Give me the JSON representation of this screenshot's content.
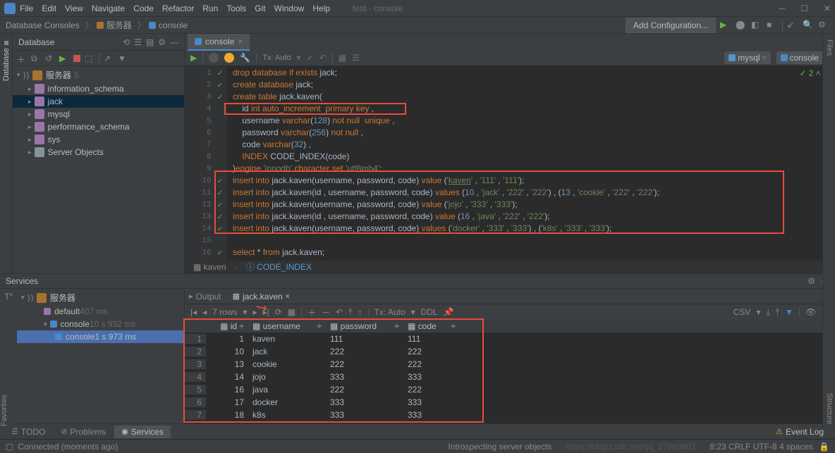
{
  "menu": {
    "file": "File",
    "edit": "Edit",
    "view": "View",
    "navigate": "Navigate",
    "code": "Code",
    "refactor": "Refactor",
    "run": "Run",
    "tools": "Tools",
    "git": "Git",
    "window": "Window",
    "help": "Help"
  },
  "titleText": "test - console",
  "breadcrumbs": {
    "a": "Database Consoles",
    "b": "服务器",
    "c": "console"
  },
  "addConfig": "Add Configuration...",
  "dbPanelTitle": "Database",
  "dbTree": {
    "server": "服务器",
    "serverCount": "5",
    "schemas": [
      "information_schema",
      "jack",
      "mysql",
      "performance_schema",
      "sys"
    ],
    "serverObjects": "Server Objects"
  },
  "tab": {
    "label": "console"
  },
  "toolbarTx": "Tx: Auto",
  "toolbarMysql": "mysql",
  "toolbarConsole": "console",
  "code": [
    "drop database if exists jack;",
    "create database jack;",
    "create table jack.kaven(",
    "    id int auto_increment  primary key ,",
    "    username varchar(128) not null  unique ,",
    "    password varchar(256) not null ,",
    "    code varchar(32) ,",
    "    INDEX CODE_INDEX(code)",
    ")engine 'innodb' character set 'utf8mb4';",
    "insert into jack.kaven(username, password, code) value ('kaven' , '111' , '111');",
    "insert into jack.kaven(id , username, password, code) values (10 , 'jack' , '222' , '222') , (13 , 'cookie' , '222' , '222');",
    "insert into jack.kaven(username, password, code) value ('jojo' , '333' , '333');",
    "insert into jack.kaven(id , username, password, code) value (16 , 'java' , '222' , '222');",
    "insert into jack.kaven(username, password, code) values ('docker' , '333' , '333') , ('k8s' , '333' , '333');",
    "",
    "select * from jack.kaven;"
  ],
  "codeCrumb": {
    "a": "kaven",
    "b": "CODE_INDEX"
  },
  "inspections": "✓ 2",
  "servicesTitle": "Services",
  "svcTree": {
    "server": "服务器",
    "default": "default",
    "defaultTime": "407 ms",
    "console": "console",
    "consoleTime": "10 s 932 ms",
    "console2": "console",
    "console2Time": "1 s 973 ms"
  },
  "outTabs": {
    "output": "Output",
    "jk": "jack.kaven"
  },
  "gridInfo": {
    "rows": "7 rows",
    "tx": "Tx: Auto",
    "ddl": "DDL",
    "csv": "CSV"
  },
  "gridCols": {
    "id": "id",
    "username": "username",
    "password": "password",
    "code": "code"
  },
  "gridData": [
    {
      "rn": "1",
      "id": "1",
      "username": "kaven",
      "password": "111",
      "code": "111"
    },
    {
      "rn": "2",
      "id": "10",
      "username": "jack",
      "password": "222",
      "code": "222"
    },
    {
      "rn": "3",
      "id": "13",
      "username": "cookie",
      "password": "222",
      "code": "222"
    },
    {
      "rn": "4",
      "id": "14",
      "username": "jojo",
      "password": "333",
      "code": "333"
    },
    {
      "rn": "5",
      "id": "16",
      "username": "java",
      "password": "222",
      "code": "222"
    },
    {
      "rn": "6",
      "id": "17",
      "username": "docker",
      "password": "333",
      "code": "333"
    },
    {
      "rn": "7",
      "id": "18",
      "username": "k8s",
      "password": "333",
      "code": "333"
    }
  ],
  "bottomTabs": {
    "todo": "TODO",
    "problems": "Problems",
    "services": "Services"
  },
  "eventLog": "Event Log",
  "statusLeft": "Connected (moments ago)",
  "statusMid": "Introspecting server objects",
  "statusRight": "8:23    CRLF    UTF-8    4 spaces",
  "watermark": "https://blog.csdn.net/qq_37960603",
  "sideDb": "Database",
  "sideFiles": "Files",
  "sideStruct": "Structure",
  "sideFav": "Favorites"
}
